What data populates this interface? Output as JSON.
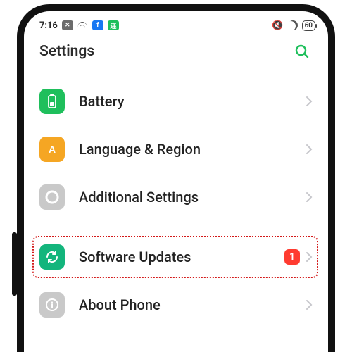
{
  "status": {
    "time": "7:16",
    "battery_percent": "60"
  },
  "header": {
    "title": "Settings"
  },
  "list": {
    "items": [
      {
        "key": "battery",
        "label": "Battery",
        "icon": "battery-icon",
        "color": "green",
        "badge": null
      },
      {
        "key": "language",
        "label": "Language & Region",
        "icon": "letter-a-icon",
        "color": "orange",
        "badge": null
      },
      {
        "key": "additional",
        "label": "Additional Settings",
        "icon": "gear-icon",
        "color": "gray",
        "badge": null
      },
      {
        "key": "software",
        "label": "Software Updates",
        "icon": "refresh-icon",
        "color": "teal",
        "badge": "1"
      },
      {
        "key": "about",
        "label": "About Phone",
        "icon": "info-icon",
        "color": "gray",
        "badge": null
      }
    ]
  },
  "colors": {
    "accent": "#1fbf5c",
    "badge": "#ff3b30",
    "highlight": "#d31818"
  }
}
